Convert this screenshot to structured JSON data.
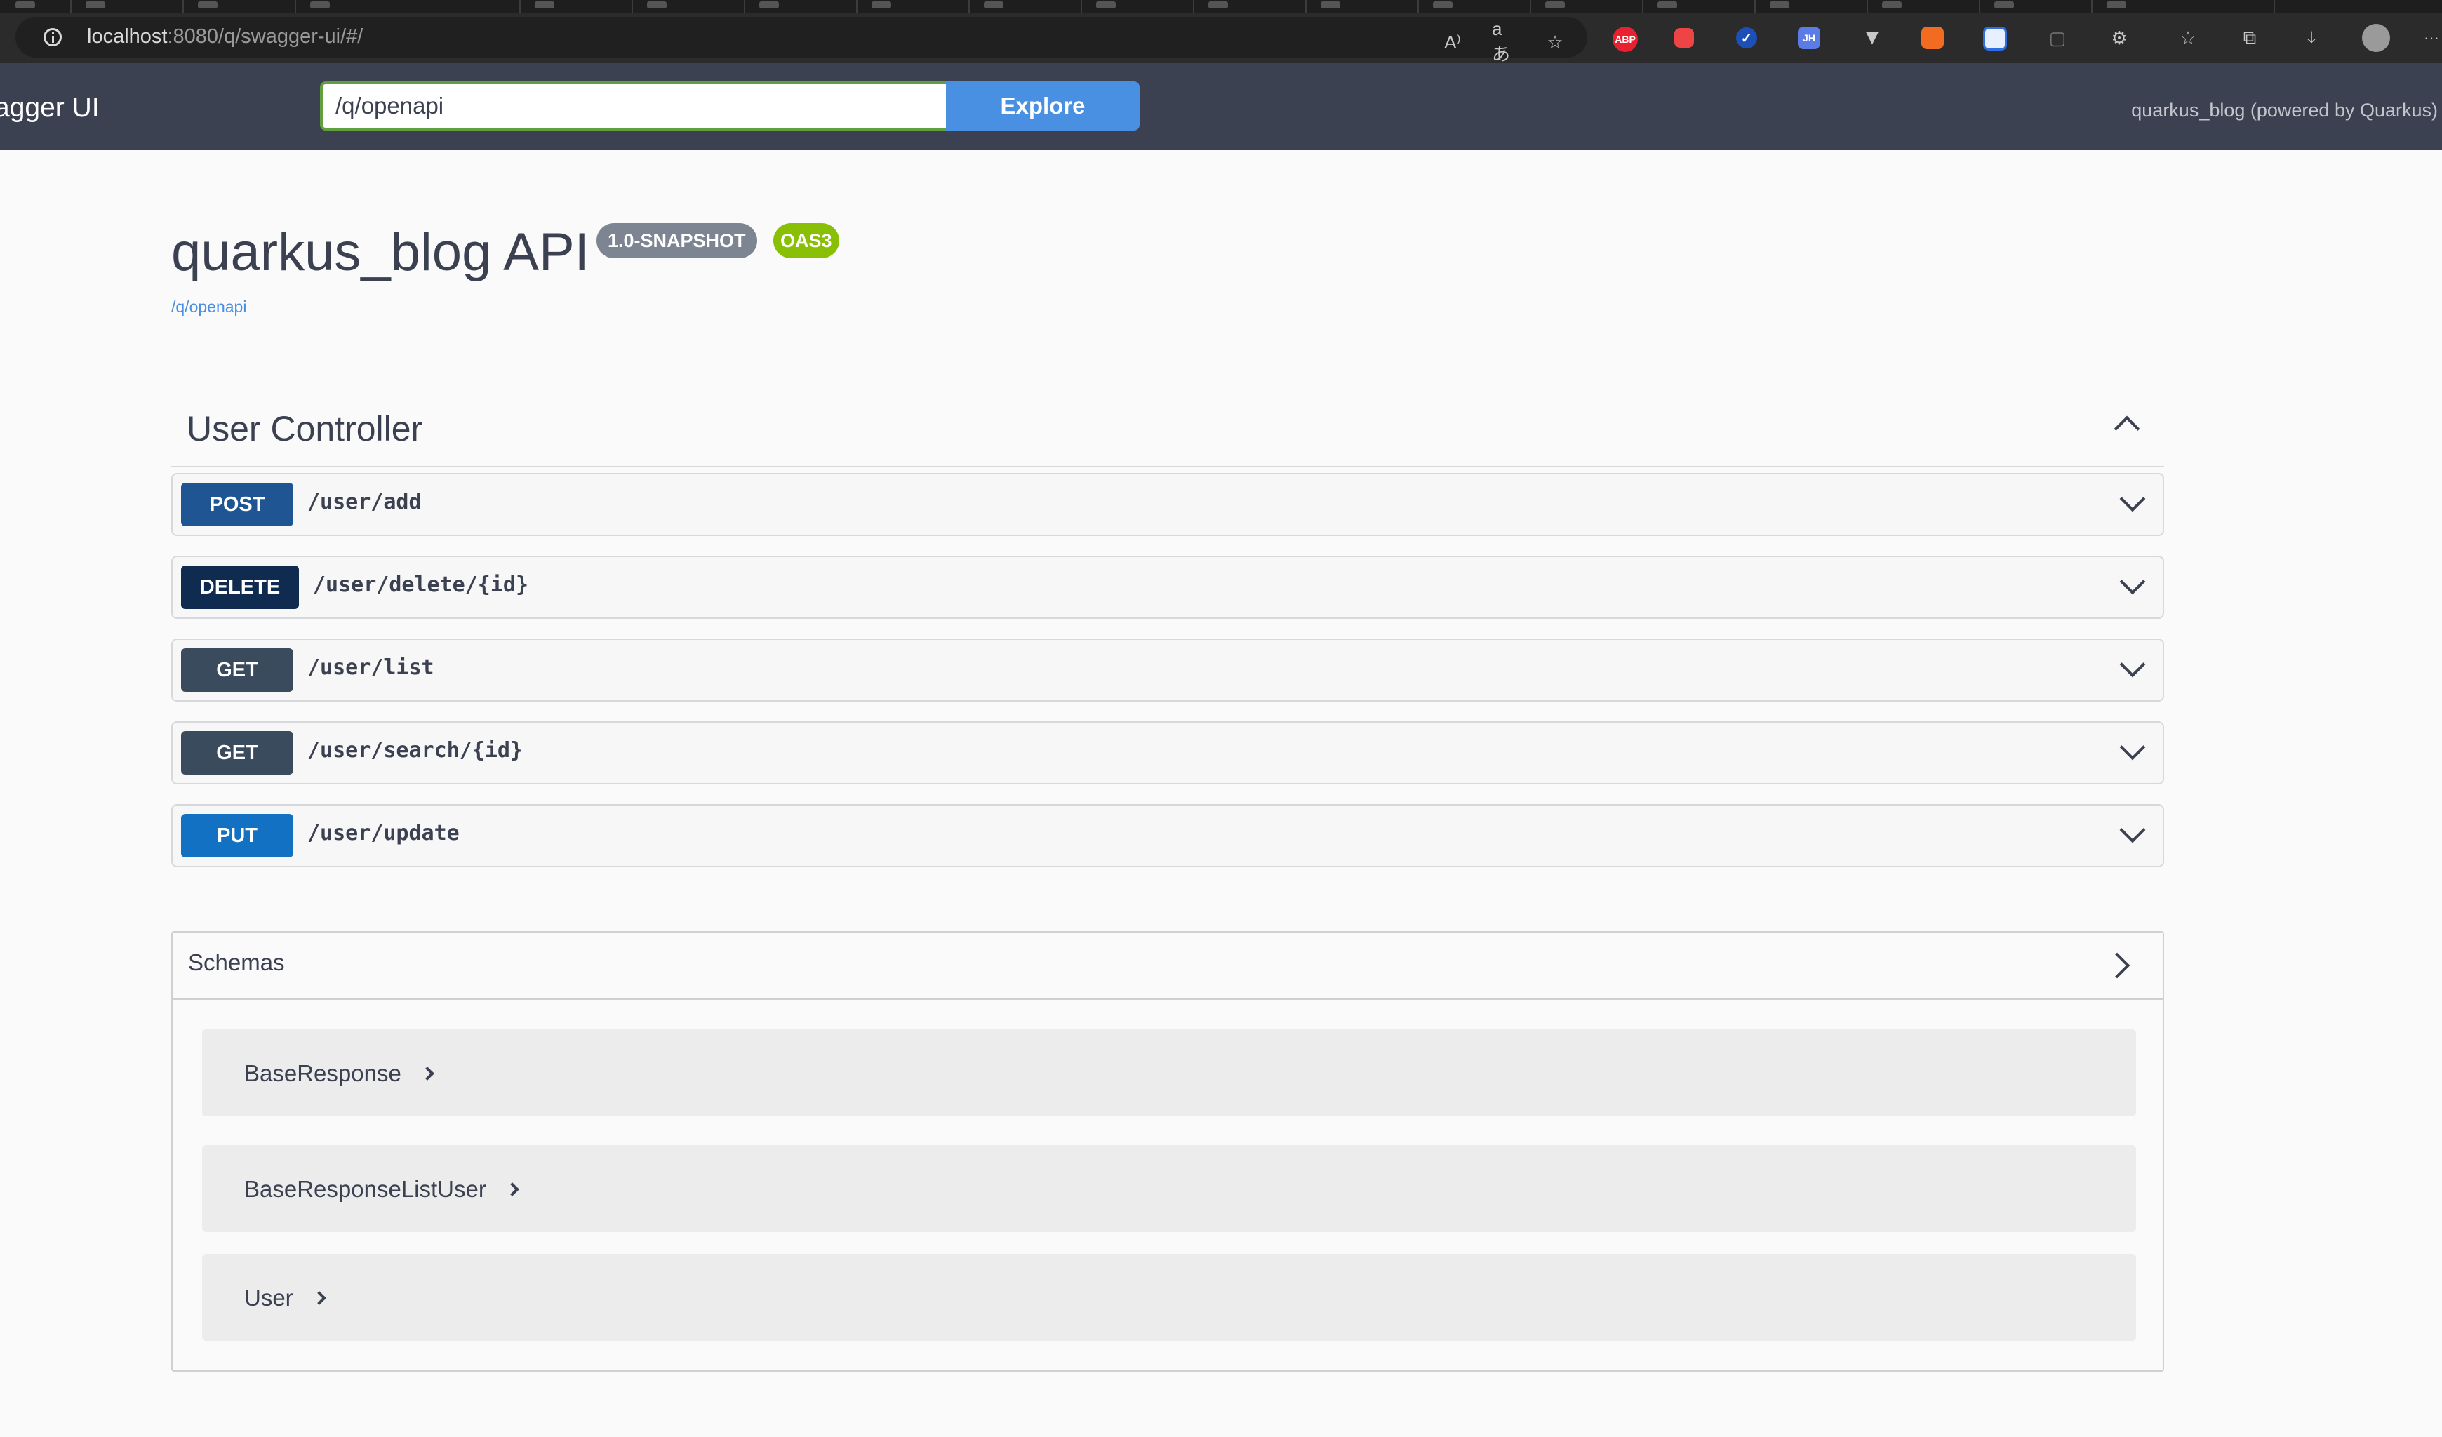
{
  "browser": {
    "url_host": "localhost",
    "url_rest": ":8080/q/swagger-ui/#/",
    "extensions": [
      "read-aloud-icon",
      "translate-icon",
      "favorite-add-icon",
      "adblock-plus-icon",
      "ext-red-icon",
      "ext-check-icon",
      "ext-jh-icon",
      "vue-devtools-icon",
      "ext-orange-icon",
      "ext-save-icon",
      "ext-tv-icon",
      "extensions-puzzle-icon",
      "favorites-icon",
      "collections-icon",
      "downloads-icon",
      "profile-avatar-icon",
      "more-menu-icon"
    ],
    "ext_labels": {
      "abp": "ABP",
      "jh": "JH"
    },
    "glyphs": {
      "read_aloud": "A⁾",
      "translate": "aあ",
      "star_add": "☆",
      "check": "✓",
      "vue": "▼",
      "tv": "▢",
      "puzzle": "⚙",
      "favorites": "☆",
      "collections": "⧉",
      "downloads": "⤓",
      "more": "···"
    }
  },
  "topbar": {
    "logo_text": "agger UI",
    "spec_url": "/q/openapi",
    "explore_label": "Explore",
    "powered_text": "quarkus_blog (powered by Quarkus)"
  },
  "info": {
    "title": "quarkus_blog API",
    "version": "1.0-SNAPSHOT",
    "oas": "OAS3",
    "spec_link": "/q/openapi"
  },
  "tag": {
    "name": "User Controller",
    "operations": [
      {
        "method": "POST",
        "path": "/user/add"
      },
      {
        "method": "DELETE",
        "path": "/user/delete/{id}"
      },
      {
        "method": "GET",
        "path": "/user/list"
      },
      {
        "method": "GET",
        "path": "/user/search/{id}"
      },
      {
        "method": "PUT",
        "path": "/user/update"
      }
    ]
  },
  "schemas": {
    "title": "Schemas",
    "models": [
      "BaseResponse",
      "BaseResponseListUser",
      "User"
    ]
  }
}
